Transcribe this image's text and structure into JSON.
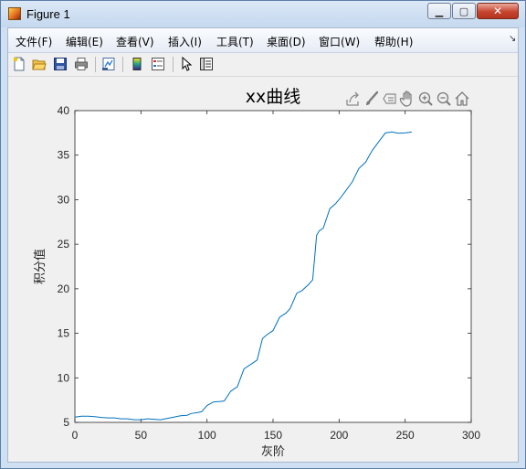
{
  "window": {
    "title": "Figure 1",
    "controls": {
      "minimize": "▁",
      "maximize": "▢",
      "close": "✕"
    }
  },
  "menu": {
    "items": [
      "文件(F)",
      "编辑(E)",
      "查看(V)",
      "插入(I)",
      "工具(T)",
      "桌面(D)",
      "窗口(W)",
      "帮助(H)"
    ],
    "overflow_icon": "dock-arrow-icon"
  },
  "toolbar": {
    "icons": [
      "new-figure-icon",
      "open-file-icon",
      "save-icon",
      "print-icon",
      "link-plot-icon",
      "insert-colorbar-icon",
      "insert-legend-icon",
      "select-arrow-icon",
      "property-inspector-icon"
    ]
  },
  "axes_toolbar": {
    "icons": [
      "export-icon",
      "brush-icon",
      "data-tips-icon",
      "pan-icon",
      "zoom-in-icon",
      "zoom-out-icon",
      "home-icon"
    ]
  },
  "colors": {
    "line": "#0072bd",
    "axes_bg": "#ffffff",
    "figure_bg": "#f0f0f0",
    "axis_text": "#262626"
  },
  "chart_data": {
    "type": "line",
    "title": "xx曲线",
    "xlabel": "灰阶",
    "ylabel": "积分值",
    "xlim": [
      0,
      300
    ],
    "ylim": [
      5,
      40
    ],
    "xticks": [
      0,
      50,
      100,
      150,
      200,
      250,
      300
    ],
    "yticks": [
      5,
      10,
      15,
      20,
      25,
      30,
      35,
      40
    ],
    "grid": false,
    "series": [
      {
        "x": [
          0,
          5,
          10,
          15,
          20,
          25,
          30,
          35,
          40,
          45,
          50,
          55,
          60,
          65,
          70,
          75,
          80,
          85,
          88,
          93,
          96,
          100,
          105,
          110,
          113,
          118,
          123,
          128,
          133,
          138,
          142,
          145,
          150,
          155,
          160,
          163,
          168,
          172,
          177,
          180,
          183,
          185,
          188,
          193,
          197,
          201,
          205,
          210,
          215,
          220,
          225,
          230,
          235,
          240,
          245,
          250,
          255
        ],
        "y": [
          5.6,
          5.7,
          5.7,
          5.65,
          5.55,
          5.5,
          5.5,
          5.4,
          5.4,
          5.3,
          5.3,
          5.4,
          5.35,
          5.3,
          5.45,
          5.6,
          5.75,
          5.8,
          6.0,
          6.1,
          6.2,
          6.9,
          7.3,
          7.35,
          7.4,
          8.5,
          9.0,
          11.0,
          11.5,
          12.0,
          14.4,
          14.8,
          15.3,
          16.8,
          17.3,
          17.8,
          19.5,
          19.8,
          20.5,
          21.0,
          26.0,
          26.5,
          26.8,
          29.0,
          29.5,
          30.2,
          31.0,
          32.0,
          33.5,
          34.2,
          35.5,
          36.5,
          37.5,
          37.6,
          37.45,
          37.5,
          37.6
        ]
      }
    ]
  }
}
